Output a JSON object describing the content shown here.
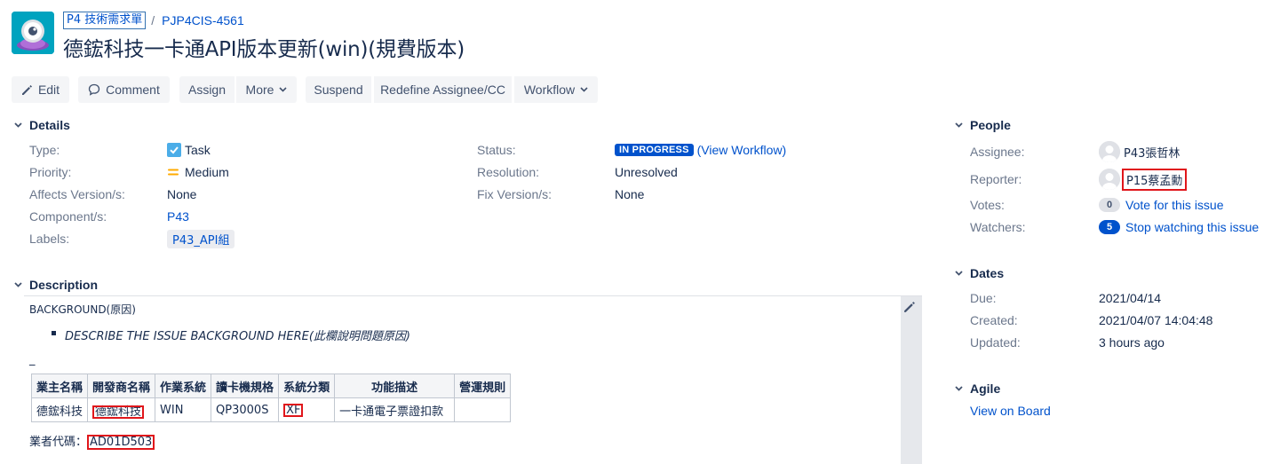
{
  "header": {
    "project": "P4 技術需求單",
    "separator": "/",
    "issue_key": "PJP4CIS-4561",
    "summary": "德鋐科技一卡通API版本更新(win)(規費版本)"
  },
  "toolbar": {
    "edit": "Edit",
    "comment": "Comment",
    "assign": "Assign",
    "more": "More",
    "suspend": "Suspend",
    "redefine": "Redefine Assignee/CC",
    "workflow": "Workflow"
  },
  "details": {
    "heading": "Details",
    "type_label": "Type:",
    "type_value": "Task",
    "priority_label": "Priority:",
    "priority_value": "Medium",
    "affects_label": "Affects Version/s:",
    "affects_value": "None",
    "component_label": "Component/s:",
    "component_value": "P43",
    "labels_label": "Labels:",
    "labels_value": "P43_API組",
    "status_label": "Status:",
    "status_value": "IN PROGRESS",
    "status_link": "(View Workflow)",
    "resolution_label": "Resolution:",
    "resolution_value": "Unresolved",
    "fix_label": "Fix Version/s:",
    "fix_value": "None"
  },
  "people": {
    "heading": "People",
    "assignee_label": "Assignee:",
    "assignee_value": "P43張哲林",
    "reporter_label": "Reporter:",
    "reporter_value": "P15蔡孟勳",
    "votes_label": "Votes:",
    "votes_count": "0",
    "votes_link": "Vote for this issue",
    "watchers_label": "Watchers:",
    "watchers_count": "5",
    "watchers_link": "Stop watching this issue"
  },
  "dates": {
    "heading": "Dates",
    "due_label": "Due:",
    "due_value": "2021/04/14",
    "created_label": "Created:",
    "created_value": "2021/04/07 14:04:48",
    "updated_label": "Updated:",
    "updated_value": "3 hours ago"
  },
  "agile": {
    "heading": "Agile",
    "link": "View on Board"
  },
  "description": {
    "heading": "Description",
    "background": "BACKGROUND(原因)",
    "bullet": "DESCRIBE THE ISSUE BACKGROUND HERE(此欄說明問題原因)",
    "dash": "_",
    "table_headers": [
      "業主名稱",
      "開發商名稱",
      "作業系統",
      "讀卡機規格",
      "系統分類",
      "功能描述",
      "營運規則"
    ],
    "table_row": [
      "德鋐科技",
      "德鋐科技",
      "WIN",
      "QP3000S",
      "XF",
      "一卡通電子票證扣款",
      ""
    ],
    "vendor_code_label": "業者代碼：",
    "vendor_code_value": "AD01D503"
  },
  "colors": {
    "link": "#0052cc",
    "status_lozenge": "#0052cc",
    "highlight_box": "#e0161b",
    "priority_medium": "#ffab00",
    "task_icon": "#4bade8",
    "project_avatar": "#00a3bf"
  },
  "icons": {
    "project": "project-avatar-icon",
    "edit": "pencil-icon",
    "comment": "comment-icon",
    "dropdown": "chevron-down-icon",
    "type": "task-checkbox-icon",
    "priority": "priority-medium-icon",
    "twisty": "chevron-down-icon",
    "user": "user-avatar-icon",
    "description_edit": "pencil-icon"
  }
}
